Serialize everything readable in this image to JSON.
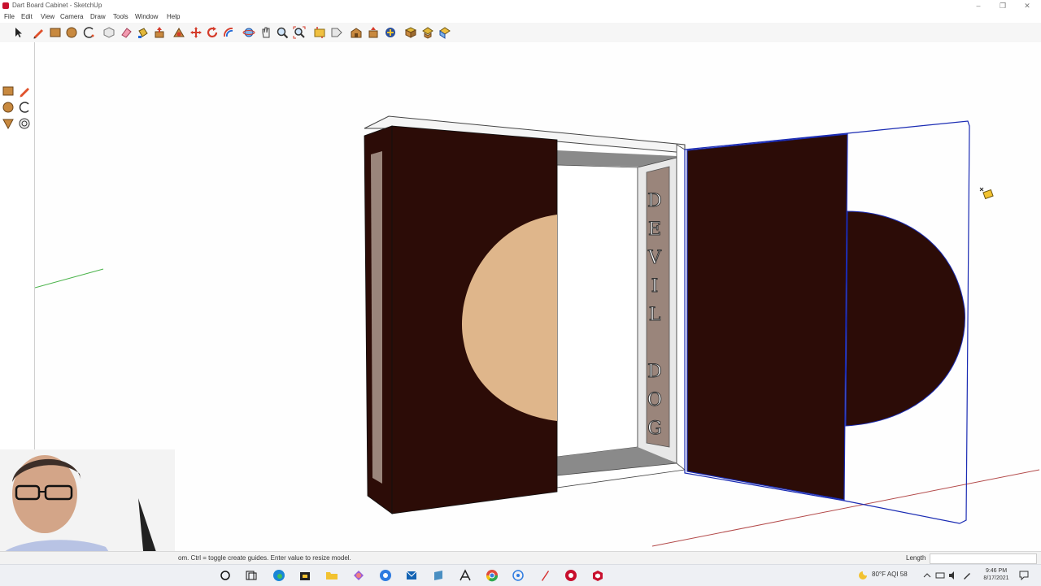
{
  "window": {
    "title": "Dart Board Cabinet - SketchUp",
    "controls": {
      "minimize": "–",
      "restore": "❐",
      "close": "✕"
    }
  },
  "menu": [
    "File",
    "Edit",
    "View",
    "Camera",
    "Draw",
    "Tools",
    "Window",
    "Help"
  ],
  "toolbar_icons": [
    "select-icon",
    "pencil-icon",
    "rectangle-icon",
    "circle-icon",
    "arc-icon",
    "make-component-icon",
    "eraser-icon",
    "paint-bucket-icon",
    "push-pull-icon",
    "follow-me-icon",
    "move-icon",
    "rotate-icon",
    "offset-icon",
    "orbit-icon",
    "pan-icon",
    "zoom-icon",
    "zoom-extents-icon",
    "section-plane-icon",
    "tag-icon",
    "warehouse-icon",
    "extension-icon",
    "3d-text-icon",
    "components-icon",
    "materials-icon",
    "styles-icon"
  ],
  "left_tools": [
    "rectangle-icon",
    "pencil-icon",
    "circle-icon",
    "arc-icon",
    "push-pull-icon",
    "offset-icon"
  ],
  "model": {
    "panel_text": "DEVIL DOG",
    "letters_top": [
      "D",
      "E",
      "V",
      "I",
      "L"
    ],
    "letters_bottom": [
      "D",
      "O",
      "G"
    ],
    "colors": {
      "wood": "#2c0c07",
      "face": "#dfb68b",
      "panel": "#9a857b",
      "frame": "#ffffff",
      "shadow": "#8a8a8a",
      "selection": "#1a2bb3"
    }
  },
  "statusbar": {
    "hint": "om.  Ctrl = toggle create guides.  Enter value to resize model.",
    "measure_label": "Length",
    "measure_value": ""
  },
  "taskbar": {
    "apps": [
      "search-icon",
      "task-view-icon",
      "edge-icon",
      "store-icon",
      "photos-icon",
      "chrome-alt-icon",
      "mail-icon",
      "files-icon",
      "tools-icon",
      "chrome-icon",
      "cortana-icon",
      "pen-icon",
      "app-red-icon",
      "sketchup-icon"
    ],
    "weather": "80°F  AQI 58",
    "time": "9:46 PM",
    "date": "8/17/2021"
  }
}
